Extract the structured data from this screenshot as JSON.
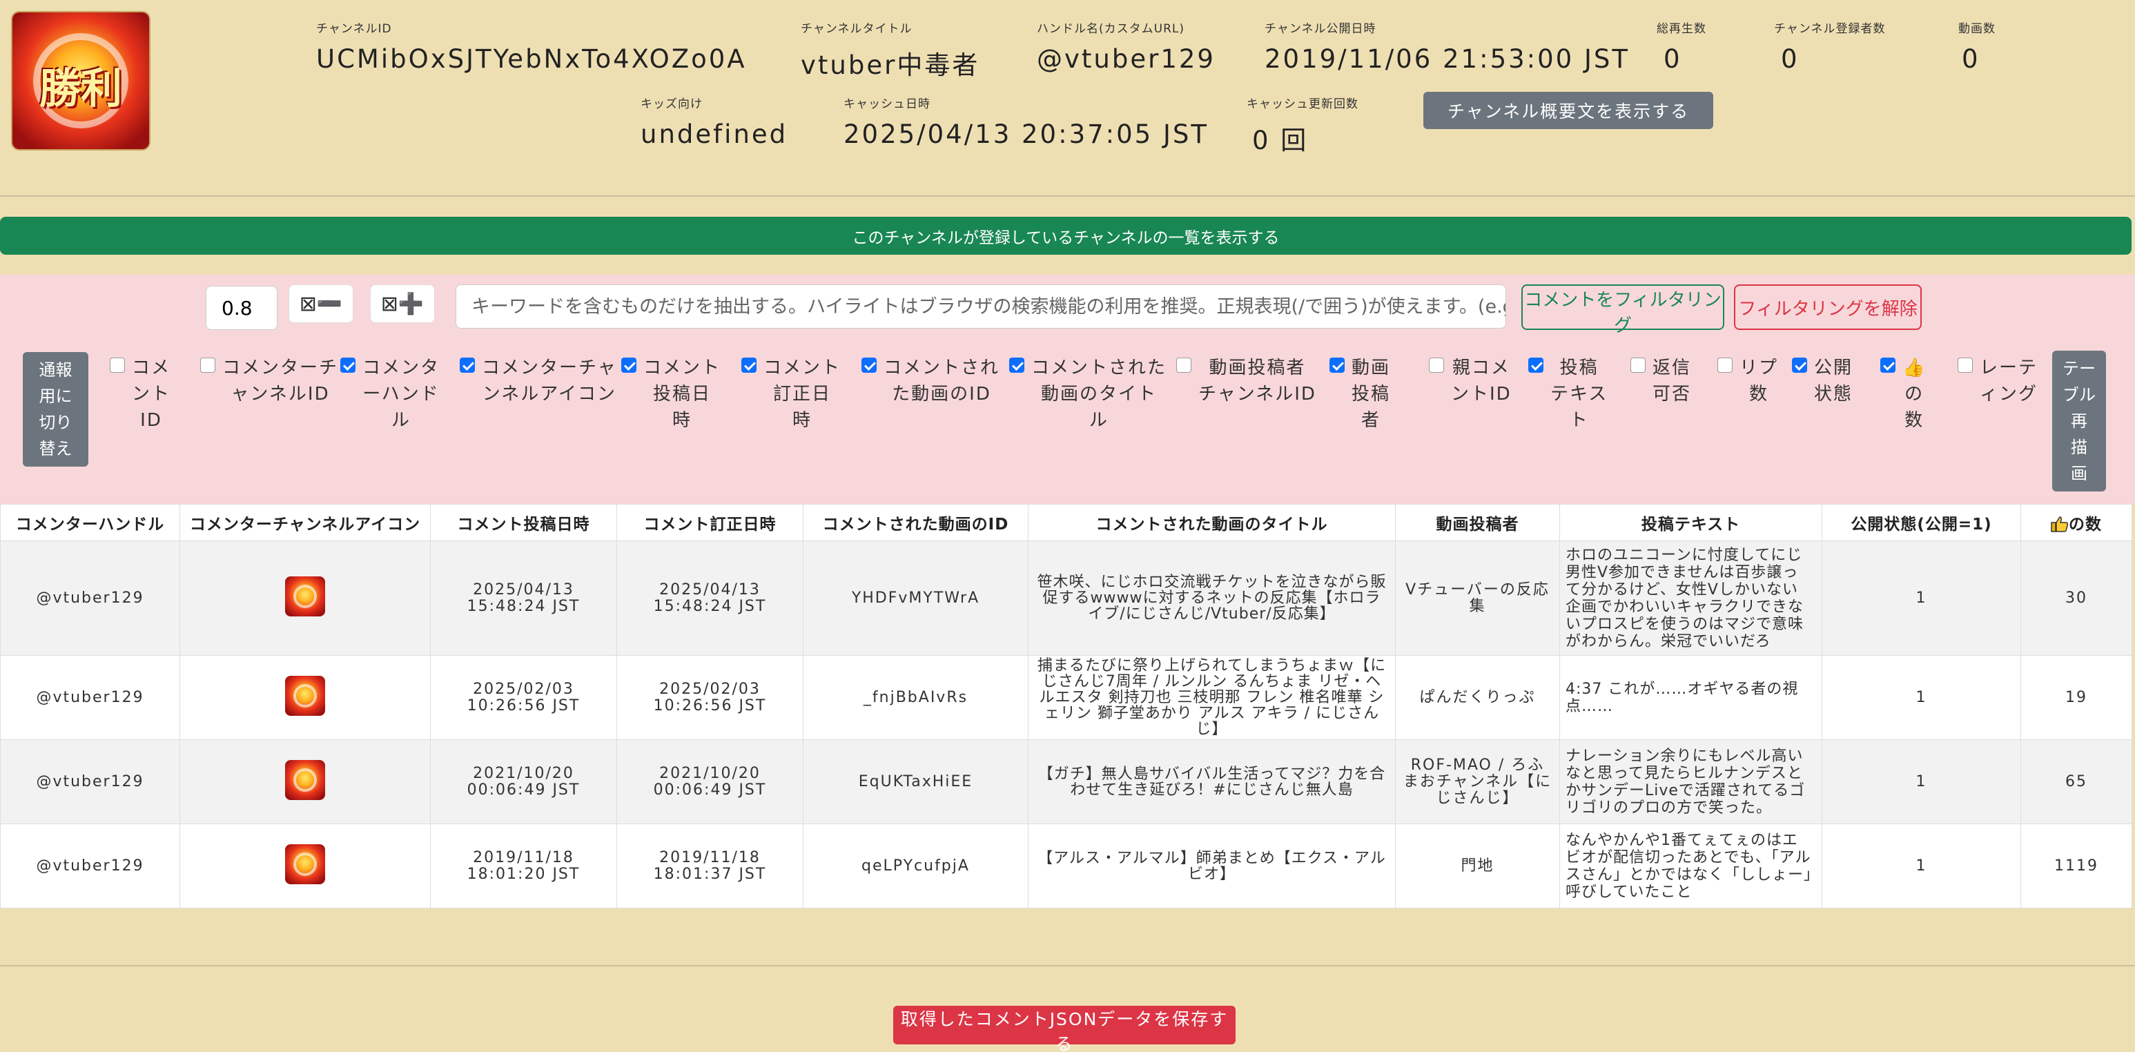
{
  "header": {
    "avatar_text": "勝利",
    "fields": [
      {
        "label": "チャンネルID",
        "value": "UCMibOxSJTYebNxTo4XOZo0A"
      },
      {
        "label": "チャンネルタイトル",
        "value": "vtuber中毒者"
      },
      {
        "label": "ハンドル名(カスタムURL)",
        "value": "@vtuber129"
      },
      {
        "label": "チャンネル公開日時",
        "value": "2019/11/06 21:53:00 JST"
      },
      {
        "label": "総再生数",
        "value": "0"
      },
      {
        "label": "チャンネル登録者数",
        "value": "0"
      },
      {
        "label": "動画数",
        "value": "0"
      },
      {
        "label": "キッズ向け",
        "value": "undefined"
      },
      {
        "label": "キャッシュ日時",
        "value": "2025/04/13 20:37:05 JST"
      },
      {
        "label": "キャッシュ更新回数",
        "value": "0 回"
      }
    ],
    "overview_button": "チャンネル概要文を表示する"
  },
  "subscriptions_button": "このチャンネルが登録しているチャンネルの一覧を表示する",
  "filter": {
    "zoom_value": "0.8",
    "zoom_out_label": "⊠➖",
    "zoom_in_label": "⊠➕",
    "keyword_placeholder": "キーワードを含むものだけを抽出する。ハイライトはブラウザの検索機能の利用を推奨。正規表現(/で囲う)が使えます。(e.g. /(BC|AD|",
    "filter_button": "コメントをフィルタリング",
    "clear_button": "フィルタリングを解除",
    "notify_button": "通報\n用に\n切り\n替え",
    "redraw_button": "テー\nブル\n再\n描\n画",
    "columns": [
      {
        "label": "コメ\nント\nID",
        "checked": false
      },
      {
        "label": "コメンターチ\nャンネルID",
        "checked": false
      },
      {
        "label": "コメンタ\nーハンド\nル",
        "checked": true
      },
      {
        "label": "コメンターチャ\nンネルアイコン",
        "checked": true
      },
      {
        "label": "コメント\n投稿日\n時",
        "checked": true
      },
      {
        "label": "コメント\n訂正日\n時",
        "checked": true
      },
      {
        "label": "コメントされ\nた動画のID",
        "checked": true
      },
      {
        "label": "コメントされた\n動画のタイト\nル",
        "checked": true
      },
      {
        "label": "動画投稿者\nチャンネルID",
        "checked": false
      },
      {
        "label": "動画\n投稿\n者",
        "checked": true
      },
      {
        "label": "親コメ\nントID",
        "checked": false
      },
      {
        "label": "投稿\nテキス\nト",
        "checked": true
      },
      {
        "label": "返信\n可否",
        "checked": false
      },
      {
        "label": "リプ\n数",
        "checked": false
      },
      {
        "label": "公開\n状態",
        "checked": true
      },
      {
        "label": "👍\nの\n数",
        "checked": true
      },
      {
        "label": "レーテ\nィング",
        "checked": false
      }
    ]
  },
  "table": {
    "headers": [
      "コメンターハンドル",
      "コメンターチャンネルアイコン",
      "コメント投稿日時",
      "コメント訂正日時",
      "コメントされた動画のID",
      "コメントされた動画のタイトル",
      "動画投稿者",
      "投稿テキスト",
      "公開状態(公開=1)",
      "の数"
    ],
    "rows": [
      {
        "handle": "@vtuber129",
        "posted": "2025/04/13\n15:48:24 JST",
        "edited": "2025/04/13\n15:48:24 JST",
        "edited_changed": false,
        "video_id": "YHDFvMYTWrA",
        "video_title": "笹木咲、にじホロ交流戦チケットを泣きながら販促するwwwwに対するネットの反応集【ホロライブ/にじさんじ/Vtuber/反応集】",
        "uploader": "Vチューバーの反応集",
        "text": "ホロのユニコーンに忖度してにじ男性V参加できませんは百歩譲って分かるけど、女性Vしかいない企画でかわいいキャラクリできないプロスピを使うのはマジで意味がわからん。栄冠でいいだろ",
        "status": "1",
        "likes": "30"
      },
      {
        "handle": "@vtuber129",
        "posted": "2025/02/03\n10:26:56 JST",
        "edited": "2025/02/03\n10:26:56 JST",
        "edited_changed": false,
        "video_id": "_fnjBbAIvRs",
        "video_title": "捕まるたびに祭り上げられてしまうちょまｗ【にじさんじ7周年 / ルンルン るんちょま リゼ・ヘルエスタ 剣持刀也 三枝明那 フレン 椎名唯華 シェリン 獅子堂あかり アルス アキラ / にじさんじ】",
        "uploader": "ぱんだくりっぷ",
        "text": "4:37 これが……オギヤる者の視点……",
        "status": "1",
        "likes": "19"
      },
      {
        "handle": "@vtuber129",
        "posted": "2021/10/20\n00:06:49 JST",
        "edited": "2021/10/20\n00:06:49 JST",
        "edited_changed": false,
        "video_id": "EqUKTaxHiEE",
        "video_title": "【ガチ】無人島サバイバル生活ってマジ？力を合わせて生き延びろ！#にじさんじ無人島",
        "uploader": "ROF-MAO / ろふまおチャンネル【にじさんじ】",
        "text": "ナレーション余りにもレベル高いなと思って見たらヒルナンデスとかサンデーLiveで活躍されてるゴリゴリのプロの方で笑った。",
        "status": "1",
        "likes": "65"
      },
      {
        "handle": "@vtuber129",
        "posted": "2019/11/18\n18:01:20 JST",
        "edited": "2019/11/18\n18:01:37 JST",
        "edited_changed": true,
        "video_id": "qeLPYcufpjA",
        "video_title": "【アルス・アルマル】師弟まとめ【エクス・アルビオ】",
        "uploader": "門地",
        "text": "なんやかんや1番てぇてぇのはエビオが配信切ったあとでも、「アルスさん」とかではなく「ししょー」呼びしていたこと",
        "status": "1",
        "likes": "1119"
      }
    ]
  },
  "save_button": "取得したコメントJSONデータを保存する",
  "colors": {
    "bg": "#eedfb3",
    "green": "#198754",
    "red": "#dc3545",
    "gray": "#6c757d",
    "panel": "#f8d7da",
    "blue": "#0d6efd"
  }
}
